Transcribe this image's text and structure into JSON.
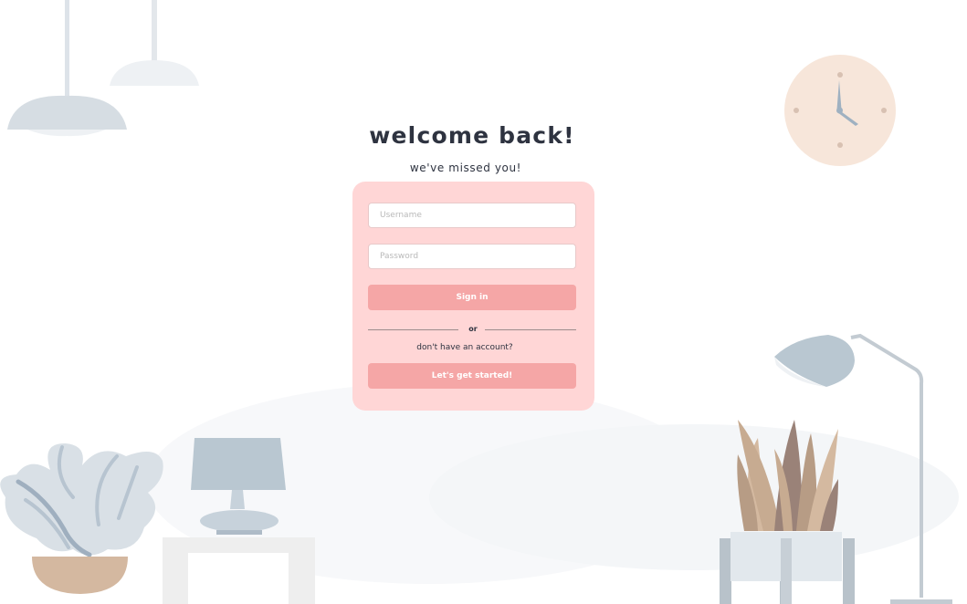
{
  "header": {
    "title": "welcome back!",
    "subtitle": "we've missed you!"
  },
  "login_form": {
    "username_placeholder": "Username",
    "password_placeholder": "Password",
    "sign_in_label": "Sign in",
    "divider_text": "or",
    "no_account_text": "don't have an account?",
    "get_started_label": "Let's get started!"
  },
  "colors": {
    "card_background": "#ffd6d6",
    "button": "#f5a6a6",
    "title_text": "#2e3340",
    "illustration_blue_gray": "#b9c7d1",
    "clock_face": "#f7e6da",
    "plant_pot": "#d4b8a0"
  },
  "illustrations": [
    "pendant-lamp-icon",
    "wall-clock-icon",
    "potted-plant-icon",
    "table-lamp-icon",
    "side-table-icon",
    "dried-plant-icon",
    "plant-stand-icon",
    "floor-lamp-icon"
  ]
}
